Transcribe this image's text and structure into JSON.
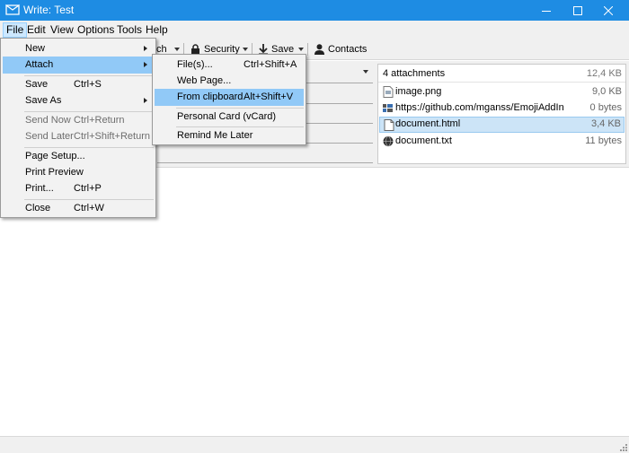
{
  "window": {
    "title": "Write: Test",
    "controls": {
      "minimize": "minimize-icon",
      "maximize": "maximize-icon",
      "close": "close-icon"
    }
  },
  "menubar": {
    "items": [
      "File",
      "Edit",
      "View",
      "Options",
      "Tools",
      "Help"
    ],
    "active": "File"
  },
  "toolbar": {
    "partial_label": "ch",
    "security_label": "Security",
    "save_label": "Save",
    "contacts_label": "Contacts"
  },
  "file_menu": {
    "new": "New",
    "attach": "Attach",
    "save": "Save",
    "save_sc": "Ctrl+S",
    "save_as": "Save As",
    "send_now": "Send Now",
    "send_now_sc": "Ctrl+Return",
    "send_later": "Send Later",
    "send_later_sc": "Ctrl+Shift+Return",
    "page_setup": "Page Setup...",
    "print_preview": "Print Preview",
    "print": "Print...",
    "print_sc": "Ctrl+P",
    "close": "Close",
    "close_sc": "Ctrl+W"
  },
  "attach_menu": {
    "files": "File(s)...",
    "files_sc": "Ctrl+Shift+A",
    "web_page": "Web Page...",
    "from_clipboard": "From clipboard",
    "from_clipboard_sc": "Alt+Shift+V",
    "personal_card": "Personal Card (vCard)",
    "remind_later": "Remind Me Later"
  },
  "attachments": {
    "count_label": "4 attachments",
    "total_size": "12,4 KB",
    "items": [
      {
        "name": "image.png",
        "size": "9,0 KB",
        "icon": "image-file-icon"
      },
      {
        "name": "https://github.com/mganss/EmojiAddIn",
        "size": "0 bytes",
        "icon": "link-icon"
      },
      {
        "name": "document.html",
        "size": "3,4 KB",
        "icon": "document-icon",
        "selected": true
      },
      {
        "name": "document.txt",
        "size": "11 bytes",
        "icon": "globe-icon"
      }
    ]
  },
  "colors": {
    "titlebar": "#1e8ce3",
    "menu_highlight": "#91c9f7",
    "selection": "#cce4f7"
  }
}
